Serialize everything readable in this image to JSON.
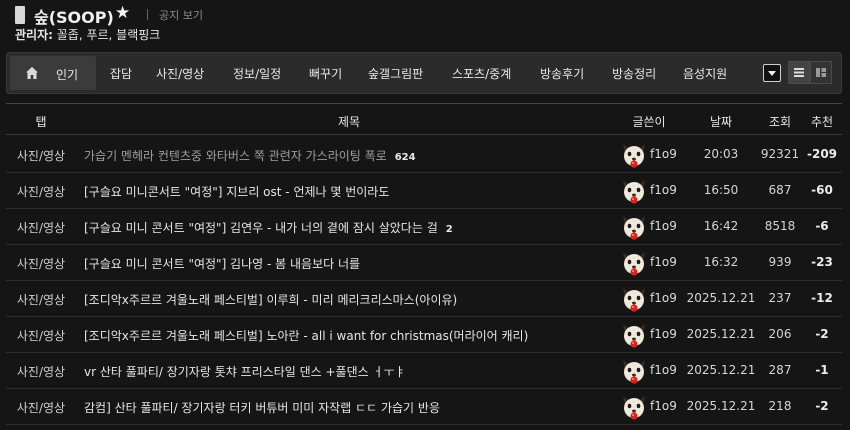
{
  "gallery": {
    "title": "숲(SOOP)",
    "notice_link": "공지 보기",
    "managers_label": "관리자:",
    "managers": "꼴좁, 푸르, 블랙핑크"
  },
  "nav": {
    "items": [
      "인기",
      "잡담",
      "사진/영상",
      "정보/일정",
      "뻐꾸기",
      "숲갤그림판",
      "스포츠/중계",
      "방송후기",
      "방송정리",
      "음성지원"
    ]
  },
  "table": {
    "headers": {
      "tab": "탭",
      "title": "제목",
      "author": "글쓴이",
      "date": "날짜",
      "views": "조회",
      "recommend": "추천"
    },
    "rows": [
      {
        "tab": "사진/영상",
        "title": "가습기 멘헤라 컨텐츠중 와타버스 쪽 관련자 가스라이팅 폭로",
        "comments": "624",
        "author": "f1o9",
        "date": "20:03",
        "views": "92321",
        "recommend": "-209"
      },
      {
        "tab": "사진/영상",
        "title": "[구슬요 미니콘서트 \"여정\"] 지브리 ost - 언제나 몇 번이라도",
        "comments": "",
        "author": "f1o9",
        "date": "16:50",
        "views": "687",
        "recommend": "-60"
      },
      {
        "tab": "사진/영상",
        "title": "[구슬요 미니 콘서트 \"여정\"] 김연우 - 내가 너의 곁에 잠시 살았다는 걸",
        "comments": "2",
        "author": "f1o9",
        "date": "16:42",
        "views": "8518",
        "recommend": "-6"
      },
      {
        "tab": "사진/영상",
        "title": "[구슬요 미니 콘서트 \"여정\"] 김나영 - 봄 내음보다 너를",
        "comments": "",
        "author": "f1o9",
        "date": "16:32",
        "views": "939",
        "recommend": "-23"
      },
      {
        "tab": "사진/영상",
        "title": "[조디악x주르르 겨울노래 페스티벌] 이루희 - 미리 메리크리스마스(아이유)",
        "comments": "",
        "author": "f1o9",
        "date": "2025.12.21",
        "views": "237",
        "recommend": "-12"
      },
      {
        "tab": "사진/영상",
        "title": "[조디악x주르르 겨울노래 페스티벌] 노아란 - all i want for christmas(머라이어 캐리)",
        "comments": "",
        "author": "f1o9",
        "date": "2025.12.21",
        "views": "206",
        "recommend": "-2"
      },
      {
        "tab": "사진/영상",
        "title": "vr 산타 풀파티/ 장기자랑 톳챠 프리스타일 댄스 +풀댄스 ㅓㅜㅑ",
        "comments": "",
        "author": "f1o9",
        "date": "2025.12.21",
        "views": "287",
        "recommend": "-1"
      },
      {
        "tab": "사진/영상",
        "title": "감컴] 산타 풀파티/ 장기자랑 터키 버튜버 미미 자작랩 ㄷㄷ 가습기 반응",
        "comments": "",
        "author": "f1o9",
        "date": "2025.12.21",
        "views": "218",
        "recommend": "-2"
      }
    ]
  },
  "colors": {
    "background": "#151515",
    "nav_bg": "#2b2b2b",
    "accent": "#e8e8e8"
  },
  "icons": {
    "home": "home-icon",
    "star": "star-icon",
    "avatar": "dog-face-icon",
    "dropdown": "chevron-down-icon",
    "list_view": "list-view-icon",
    "grid_view": "grid-view-icon"
  }
}
